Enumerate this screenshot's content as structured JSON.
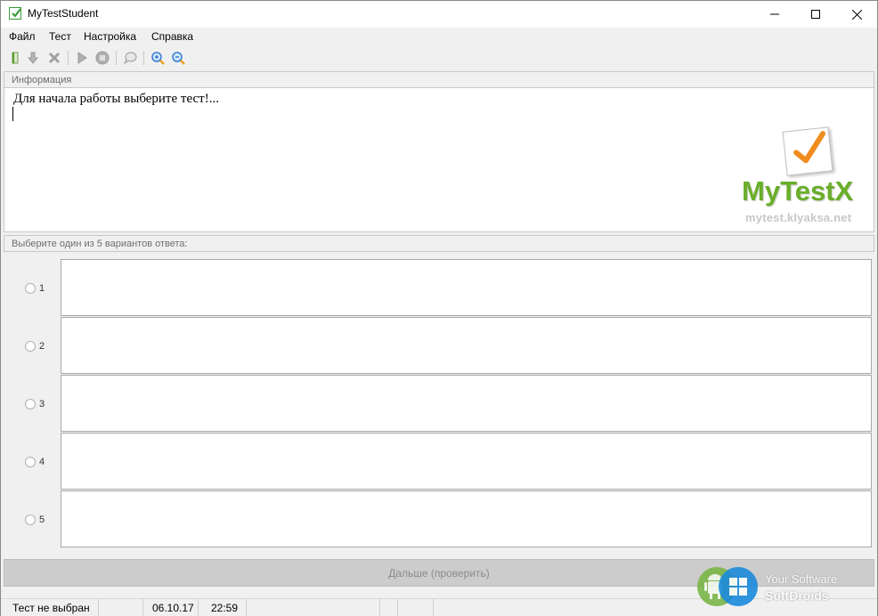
{
  "window": {
    "title": "MyTestStudent"
  },
  "menu": [
    "Файл",
    "Тест",
    "Настройка",
    "Справка"
  ],
  "info": {
    "header": "Информация",
    "text": "Для начала работы выберите тест!...",
    "logo_word": "MyTestX",
    "logo_url": "mytest.klyaksa.net"
  },
  "answers": {
    "header": "Выберите один из 5 вариантов ответа:",
    "items": [
      "1",
      "2",
      "3",
      "4",
      "5"
    ]
  },
  "next_button": "Дальше (проверить)",
  "status": {
    "test": "Тест не выбран",
    "date": "06.10.17",
    "time": "22:59"
  },
  "watermark": {
    "line1": "Your Software",
    "line2": "SoftDroids"
  },
  "colors": {
    "logo_green": "#6aae2a",
    "check_orange": "#f08c1e",
    "accent_blue": "#1c8adb"
  }
}
